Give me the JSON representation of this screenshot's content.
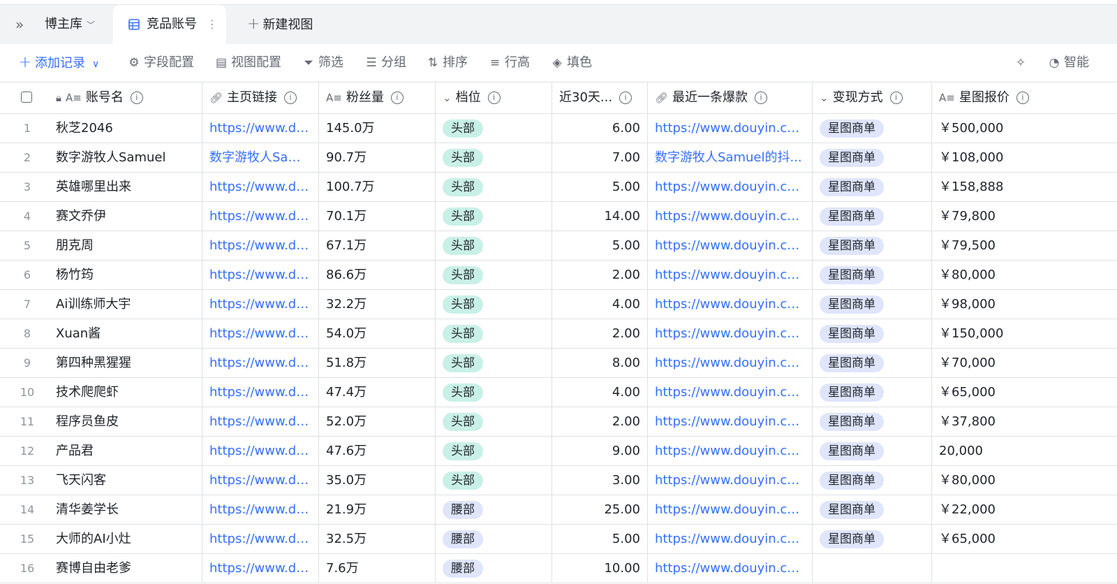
{
  "tabs": {
    "database": "博主库",
    "active_view": "竞品账号",
    "new_view": "新建视图"
  },
  "toolbar": {
    "add_record": "添加记录",
    "field_config": "字段配置",
    "view_config": "视图配置",
    "filter": "筛选",
    "group": "分组",
    "sort": "排序",
    "row_height": "行高",
    "fill_color": "填色",
    "smart": "智能"
  },
  "columns": {
    "name": "账号名",
    "home": "主页链接",
    "fans": "粉丝量",
    "tier": "档位",
    "last30": "近30天...",
    "hot": "最近一条爆款",
    "monetize": "变现方式",
    "price": "星图报价"
  },
  "rows": [
    {
      "idx": "1",
      "name": "秋芝2046",
      "home": "https://www.do...",
      "fans": "145.0万",
      "tier": "头部",
      "last30": "6.00",
      "hot": "https://www.douyin.co...",
      "monetize": "星图商单",
      "price": "￥500,000"
    },
    {
      "idx": "2",
      "name": "数字游牧人Samuel",
      "home": "数字游牧人Sam...",
      "fans": "90.7万",
      "tier": "头部",
      "last30": "7.00",
      "hot": "数字游牧人Samuel的抖...",
      "monetize": "星图商单",
      "price": "￥108,000"
    },
    {
      "idx": "3",
      "name": "英雄哪里出来",
      "home": "https://www.do...",
      "fans": "100.7万",
      "tier": "头部",
      "last30": "5.00",
      "hot": "https://www.douyin.co...",
      "monetize": "星图商单",
      "price": "￥158,888"
    },
    {
      "idx": "4",
      "name": "赛文乔伊",
      "home": "https://www.do...",
      "fans": "70.1万",
      "tier": "头部",
      "last30": "14.00",
      "hot": "https://www.douyin.co...",
      "monetize": "星图商单",
      "price": "￥79,800"
    },
    {
      "idx": "5",
      "name": "朋克周",
      "home": "https://www.do...",
      "fans": "67.1万",
      "tier": "头部",
      "last30": "5.00",
      "hot": "https://www.douyin.co...",
      "monetize": "星图商单",
      "price": "￥79,500"
    },
    {
      "idx": "6",
      "name": "杨竹筠",
      "home": "https://www.do...",
      "fans": "86.6万",
      "tier": "头部",
      "last30": "2.00",
      "hot": "https://www.douyin.co...",
      "monetize": "星图商单",
      "price": "￥80,000"
    },
    {
      "idx": "7",
      "name": "Ai训练师大宇",
      "home": "https://www.do...",
      "fans": "32.2万",
      "tier": "头部",
      "last30": "4.00",
      "hot": "https://www.douyin.co...",
      "monetize": "星图商单",
      "price": "￥98,000"
    },
    {
      "idx": "8",
      "name": "Xuan酱",
      "home": "https://www.do...",
      "fans": "54.0万",
      "tier": "头部",
      "last30": "2.00",
      "hot": "https://www.douyin.co...",
      "monetize": "星图商单",
      "price": "￥150,000"
    },
    {
      "idx": "9",
      "name": "第四种黑猩猩",
      "home": "https://www.do...",
      "fans": "51.8万",
      "tier": "头部",
      "last30": "8.00",
      "hot": "https://www.douyin.co...",
      "monetize": "星图商单",
      "price": "￥70,000"
    },
    {
      "idx": "10",
      "name": "技术爬爬虾",
      "home": "https://www.do...",
      "fans": "47.4万",
      "tier": "头部",
      "last30": "4.00",
      "hot": "https://www.douyin.co...",
      "monetize": "星图商单",
      "price": "￥65,000"
    },
    {
      "idx": "11",
      "name": "程序员鱼皮",
      "home": "https://www.do...",
      "fans": "52.0万",
      "tier": "头部",
      "last30": "2.00",
      "hot": "https://www.douyin.co...",
      "monetize": "星图商单",
      "price": "￥37,800"
    },
    {
      "idx": "12",
      "name": "产品君",
      "home": "https://www.do...",
      "fans": "47.6万",
      "tier": "头部",
      "last30": "9.00",
      "hot": "https://www.douyin.co...",
      "monetize": "星图商单",
      "price": "20,000"
    },
    {
      "idx": "13",
      "name": "飞天闪客",
      "home": "https://www.do...",
      "fans": "35.0万",
      "tier": "头部",
      "last30": "3.00",
      "hot": "https://www.douyin.co...",
      "monetize": "星图商单",
      "price": "￥80,000"
    },
    {
      "idx": "14",
      "name": "清华姜学长",
      "home": "https://www.do...",
      "fans": "21.9万",
      "tier": "腰部",
      "last30": "25.00",
      "hot": "https://www.douyin.co...",
      "monetize": "星图商单",
      "price": "￥22,000"
    },
    {
      "idx": "15",
      "name": "大师的AI小灶",
      "home": "https://www.do...",
      "fans": "32.5万",
      "tier": "腰部",
      "last30": "5.00",
      "hot": "https://www.douyin.co...",
      "monetize": "星图商单",
      "price": "￥65,000"
    },
    {
      "idx": "16",
      "name": "赛博自由老爹",
      "home": "https://www.do...",
      "fans": "7.6万",
      "tier": "腰部",
      "last30": "10.00",
      "hot": "https://www.douyin.co...",
      "monetize": "",
      "price": ""
    }
  ],
  "colors": {
    "accent": "#3370ff",
    "tier_head_bg": "#c9f0e7",
    "tier_waist_bg": "#dfe5fb",
    "monetize_bg": "#dfe5fb"
  }
}
